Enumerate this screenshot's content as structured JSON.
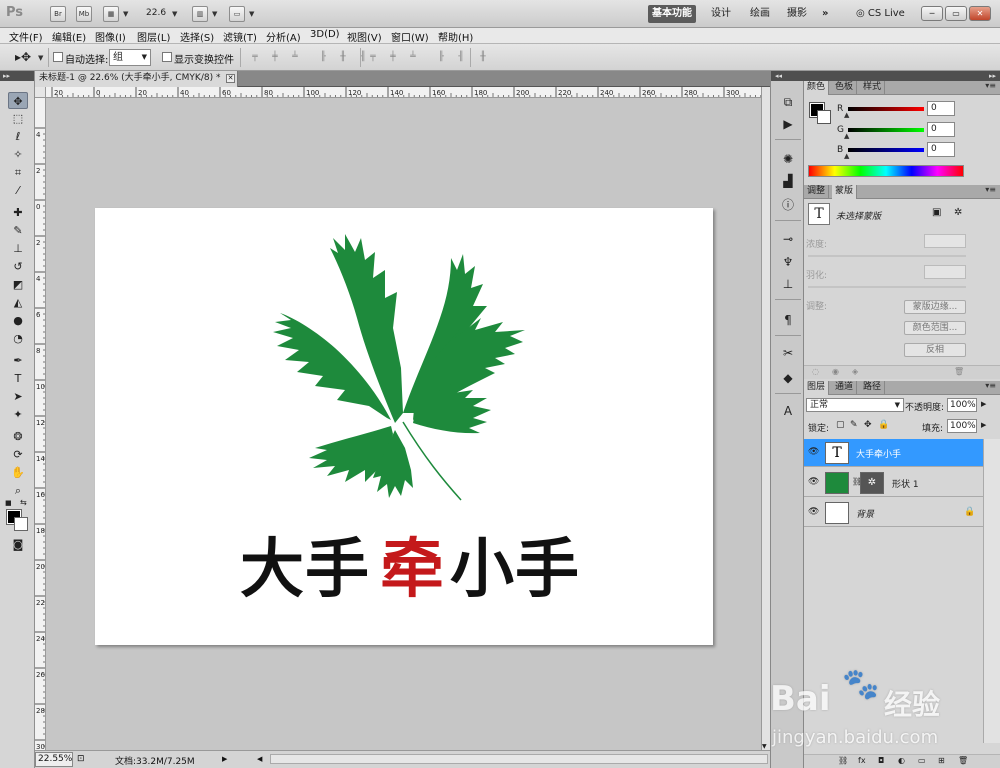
{
  "app": {
    "logo": "Ps",
    "bridge_label": "Br",
    "mini_bridge_label": "Mb",
    "zoom": "22.6",
    "workspaces": [
      "基本功能",
      "设计",
      "绘画",
      "摄影"
    ],
    "more": "»",
    "cs_live": "CS Live",
    "window_buttons": [
      "─",
      "▭",
      "✕"
    ]
  },
  "menu": [
    "文件(F)",
    "编辑(E)",
    "图像(I)",
    "图层(L)",
    "选择(S)",
    "滤镜(T)",
    "分析(A)",
    "3D(D)",
    "视图(V)",
    "窗口(W)",
    "帮助(H)"
  ],
  "options": {
    "auto_select_label": "自动选择:",
    "auto_select_value": "组",
    "show_transform_label": "显示变换控件"
  },
  "document": {
    "tab_title": "未标题-1 @ 22.6% (大手牵小手, CMYK/8) *",
    "close": "✕",
    "text_parts": [
      "大手",
      "牵",
      "小手"
    ],
    "accent_color": "#c4191b",
    "leaf_color": "#1e8a3c",
    "ruler_top_labels": [
      "20",
      "0",
      "20",
      "40",
      "60",
      "80",
      "100",
      "120",
      "140",
      "160",
      "180",
      "200",
      "220",
      "240",
      "260",
      "280",
      "300"
    ],
    "ruler_left_labels": [
      "4",
      "2",
      "0",
      "2",
      "4",
      "6",
      "8",
      "10",
      "12",
      "14",
      "16",
      "18",
      "20",
      "22",
      "24",
      "26",
      "28",
      "30"
    ]
  },
  "status": {
    "zoom": "22.55%",
    "doc_info": "文档:33.2M/7.25M"
  },
  "color_panel": {
    "tabs": [
      "颜色",
      "色板",
      "样式"
    ],
    "channels": [
      {
        "label": "R",
        "value": "0"
      },
      {
        "label": "G",
        "value": "0"
      },
      {
        "label": "B",
        "value": "0"
      }
    ]
  },
  "masks_panel": {
    "tabs": [
      "调整",
      "蒙版"
    ],
    "title": "未选择蒙版",
    "density_label": "浓度:",
    "feather_label": "羽化:",
    "refine_label": "调整:",
    "buttons": [
      "蒙版边缘...",
      "颜色范围...",
      "反相"
    ]
  },
  "layers_panel": {
    "tabs": [
      "图层",
      "通道",
      "路径"
    ],
    "blend_mode": "正常",
    "opacity_label": "不透明度:",
    "opacity_value": "100%",
    "lock_label": "锁定:",
    "fill_label": "填充:",
    "fill_value": "100%",
    "layers": [
      {
        "name": "大手牵小手",
        "thumb": "T",
        "selected": true
      },
      {
        "name": "形状 1",
        "selected": false
      },
      {
        "name": "背景",
        "selected": false
      }
    ]
  },
  "watermark": {
    "brand": "Bai",
    "brand_cn": "经验",
    "url": "jingyan.baidu.com"
  }
}
